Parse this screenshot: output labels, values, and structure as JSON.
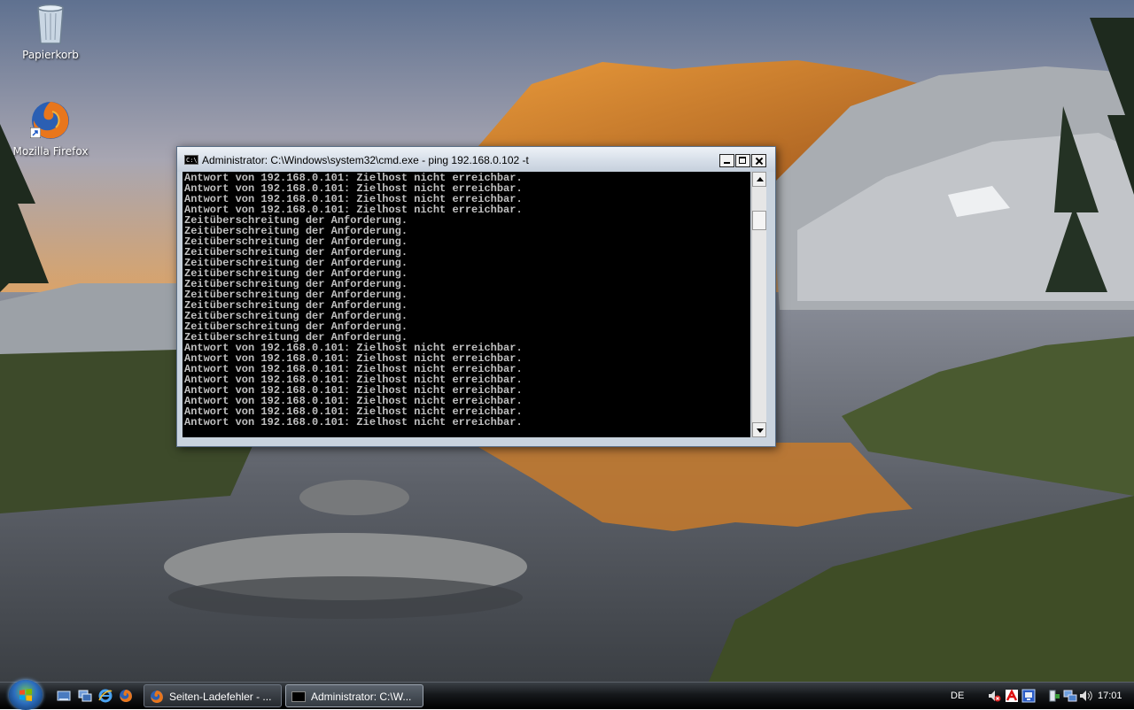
{
  "desktop": {
    "icons": [
      {
        "label": "Papierkorb"
      },
      {
        "label": "Mozilla Firefox"
      }
    ]
  },
  "window": {
    "title": "Administrator: C:\\Windows\\system32\\cmd.exe - ping  192.168.0.102 -t",
    "app_icon_text": "C:\\",
    "console_lines": [
      "Antwort von 192.168.0.101: Zielhost nicht erreichbar.",
      "Antwort von 192.168.0.101: Zielhost nicht erreichbar.",
      "Antwort von 192.168.0.101: Zielhost nicht erreichbar.",
      "Antwort von 192.168.0.101: Zielhost nicht erreichbar.",
      "Zeitüberschreitung der Anforderung.",
      "Zeitüberschreitung der Anforderung.",
      "Zeitüberschreitung der Anforderung.",
      "Zeitüberschreitung der Anforderung.",
      "Zeitüberschreitung der Anforderung.",
      "Zeitüberschreitung der Anforderung.",
      "Zeitüberschreitung der Anforderung.",
      "Zeitüberschreitung der Anforderung.",
      "Zeitüberschreitung der Anforderung.",
      "Zeitüberschreitung der Anforderung.",
      "Zeitüberschreitung der Anforderung.",
      "Zeitüberschreitung der Anforderung.",
      "Antwort von 192.168.0.101: Zielhost nicht erreichbar.",
      "Antwort von 192.168.0.101: Zielhost nicht erreichbar.",
      "Antwort von 192.168.0.101: Zielhost nicht erreichbar.",
      "Antwort von 192.168.0.101: Zielhost nicht erreichbar.",
      "Antwort von 192.168.0.101: Zielhost nicht erreichbar.",
      "Antwort von 192.168.0.101: Zielhost nicht erreichbar.",
      "Antwort von 192.168.0.101: Zielhost nicht erreichbar.",
      "Antwort von 192.168.0.101: Zielhost nicht erreichbar."
    ],
    "console_text_color": "#c0c0c0",
    "console_bg_color": "#000000"
  },
  "taskbar": {
    "quick_launch": [
      "show-desktop-icon",
      "switch-windows-icon",
      "internet-explorer-icon",
      "firefox-icon"
    ],
    "buttons": [
      {
        "label": "Seiten-Ladefehler - ...",
        "icon": "firefox-icon"
      },
      {
        "label": "Administrator: C:\\W...",
        "icon": "cmd-icon"
      }
    ],
    "language": "DE",
    "tray_icons": [
      "volume-muted-icon",
      "antivirus-icon",
      "network-status-icon",
      "safely-remove-icon",
      "network-icon",
      "volume-icon"
    ],
    "clock": "17:01"
  }
}
